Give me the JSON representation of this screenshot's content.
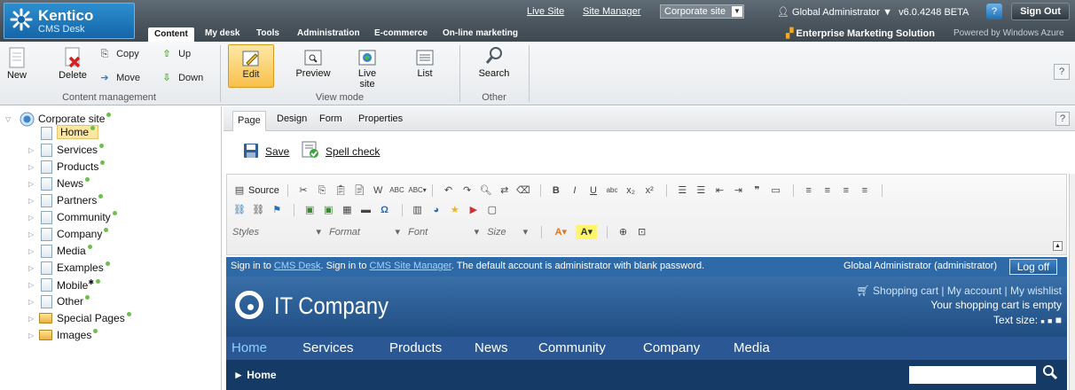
{
  "app": {
    "brand": "Kentico",
    "sub": "CMS Desk",
    "main_tabs": [
      "Content",
      "My desk",
      "Tools",
      "Administration",
      "E-commerce",
      "On-line marketing"
    ],
    "links": {
      "live_site": "Live Site",
      "site_manager": "Site Manager"
    },
    "site_select": "Corporate site",
    "user": "Global Administrator ▼",
    "version": "v6.0.4248 BETA",
    "sign_out": "Sign Out",
    "ems": "Enterprise Marketing Solution",
    "powered": "Powered by Windows Azure"
  },
  "ribbon": {
    "new": "New",
    "delete": "Delete",
    "copy": "Copy",
    "move": "Move",
    "up": "Up",
    "down": "Down",
    "group_content": "Content management",
    "edit": "Edit",
    "preview": "Preview",
    "live_site": "Live site",
    "list": "List",
    "group_view": "View mode",
    "search": "Search",
    "group_other": "Other",
    "help": "?"
  },
  "tree": {
    "root": "Corporate site",
    "items": [
      "Home",
      "Services",
      "Products",
      "News",
      "Partners",
      "Community",
      "Company",
      "Media",
      "Examples",
      "Mobile",
      "Other",
      "Special Pages",
      "Images"
    ]
  },
  "edit": {
    "subtabs": [
      "Page",
      "Design",
      "Form",
      "Properties"
    ],
    "help": "?",
    "save": "Save",
    "spell_check": "Spell check",
    "source": "Source",
    "styles": "Styles",
    "format": "Format",
    "font": "Font",
    "size": "Size"
  },
  "site": {
    "sign_msg_1": "Sign in to ",
    "sign_link_1": "CMS Desk",
    "sign_msg_2": ". Sign in to ",
    "sign_link_2": "CMS Site Manager",
    "sign_msg_3": ". The default account is administrator with blank password.",
    "who": "Global Administrator (administrator)",
    "log_off": "Log off",
    "name": "IT Company",
    "top_links": "Shopping cart | My account | My wishlist",
    "cart_status": "Your shopping cart is empty",
    "text_size": "Text size:",
    "nav": [
      "Home",
      "Services",
      "Products",
      "News",
      "Community",
      "Company",
      "Media"
    ],
    "breadcrumb": "► Home"
  },
  "colors": {
    "accent": "#1565a8",
    "status_dot": "#6cc04a",
    "selected": "#fde6a0"
  }
}
